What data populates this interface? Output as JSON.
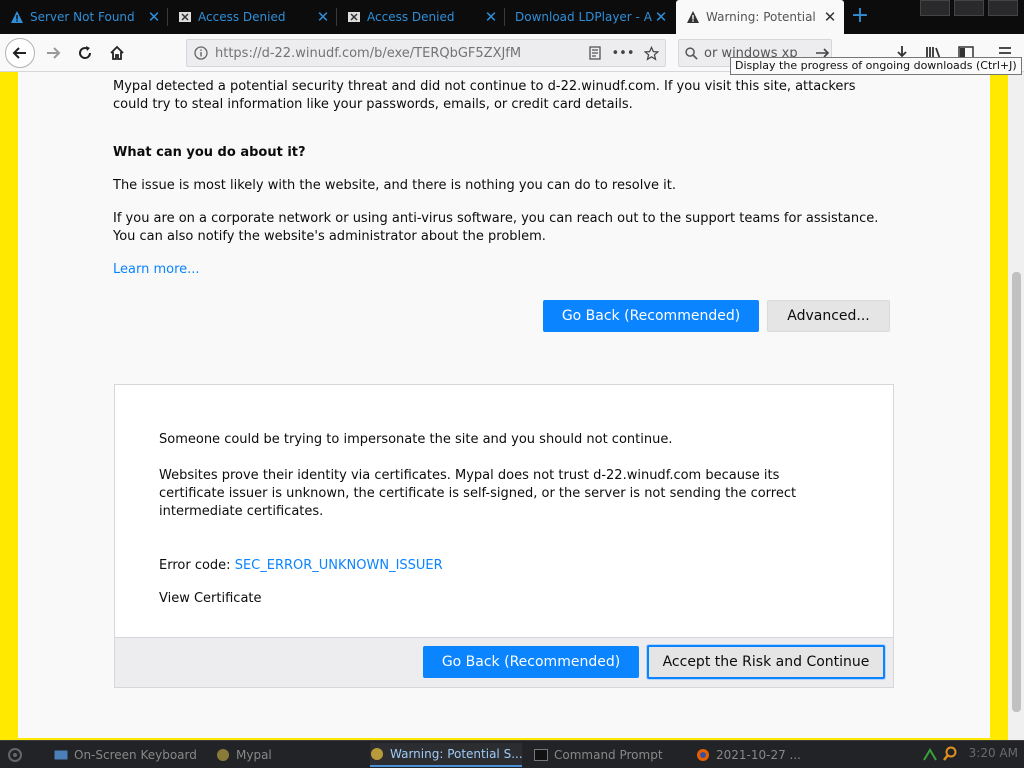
{
  "tabs": [
    {
      "label": "Server Not Found",
      "icon": "warning-icon"
    },
    {
      "label": "Access Denied",
      "icon": "shield-icon"
    },
    {
      "label": "Access Denied",
      "icon": "shield-icon"
    },
    {
      "label": "Download LDPlayer - A",
      "icon": "none"
    },
    {
      "label": "Warning: Potential",
      "icon": "warning-icon"
    }
  ],
  "navbar": {
    "url": "https://d-22.winudf.com/b/exe/TERQbGF5ZXJfM",
    "search_value": "or windows xp"
  },
  "tooltip": "Display the progress of ongoing downloads (Ctrl+J)",
  "content": {
    "intro": "Mypal detected a potential security threat and did not continue to d-22.winudf.com. If you visit this site, attackers could try to steal information like your passwords, emails, or credit card details.",
    "what_heading": "What can you do about it?",
    "para1": "The issue is most likely with the website, and there is nothing you can do to resolve it.",
    "para2": "If you are on a corporate network or using anti-virus software, you can reach out to the support teams for assistance. You can also notify the website's administrator about the problem.",
    "learn_more": "Learn more...",
    "go_back": "Go Back (Recommended)",
    "advanced": "Advanced..."
  },
  "advanced_panel": {
    "line1": "Someone could be trying to impersonate the site and you should not continue.",
    "line2": "Websites prove their identity via certificates. Mypal does not trust d-22.winudf.com because its certificate issuer is unknown, the certificate is self-signed, or the server is not sending the correct intermediate certificates.",
    "error_label": "Error code: ",
    "error_code": "SEC_ERROR_UNKNOWN_ISSUER",
    "view_cert": "View Certificate",
    "go_back": "Go Back (Recommended)",
    "accept": "Accept the Risk and Continue"
  },
  "taskbar": {
    "items": [
      "On-Screen Keyboard",
      "Mypal",
      "Warning: Potential S...",
      "Command Prompt",
      "2021-10-27 ..."
    ],
    "clock": "3:20 AM"
  },
  "colors": {
    "accent": "#0a84ff",
    "warning_stripe": "#ffe900"
  }
}
